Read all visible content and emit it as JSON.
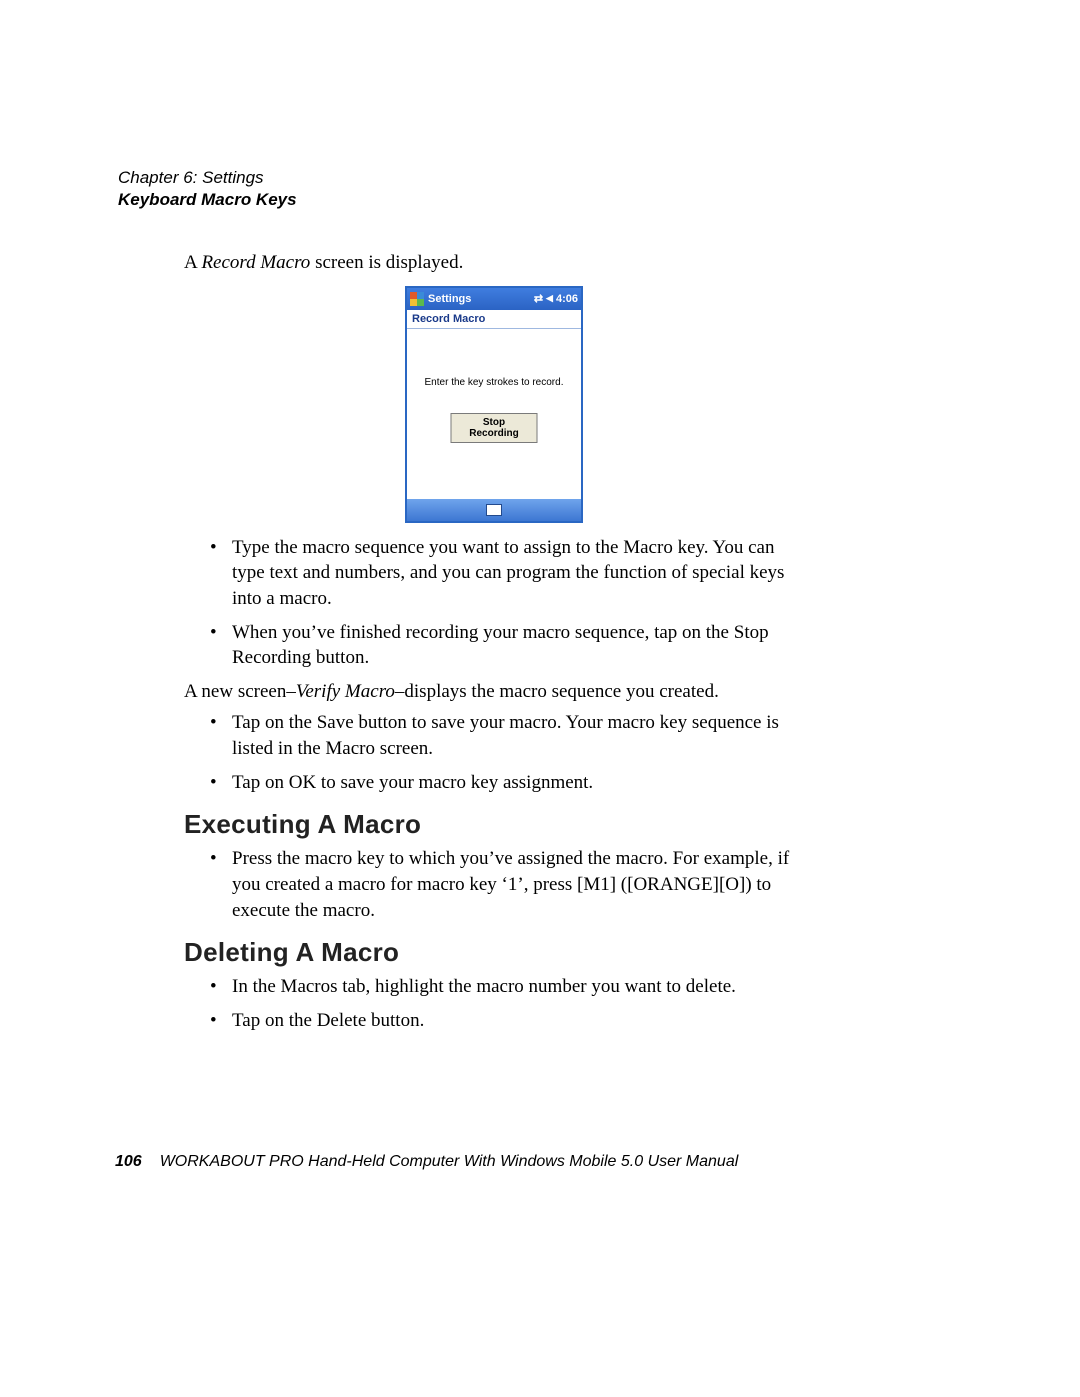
{
  "header": {
    "chapter": "Chapter 6:  Settings",
    "section": "Keyboard Macro Keys"
  },
  "intro": {
    "prefix": "A ",
    "italic": "Record Macro",
    "suffix": " screen is displayed."
  },
  "wm": {
    "title": "Settings",
    "time": "4:06",
    "subtitle": "Record Macro",
    "instruction": "Enter the key strokes to record.",
    "stop_button": "Stop Recording"
  },
  "bullets1": {
    "b1": "Type the macro sequence you want to assign to the Macro key. You can type text and numbers, and you can program the function of special keys into a macro.",
    "b2_pre": "When you’ve finished recording your macro sequence, tap on the ",
    "b2_bold": "Stop Recording",
    "b2_post": " button."
  },
  "verify": {
    "pre": "A new screen–",
    "italic": "Verify Macro",
    "post": "–displays the macro sequence you created."
  },
  "bullets2": {
    "b1_pre": "Tap on the ",
    "b1_bold": "Save",
    "b1_mid": " button to save your macro. Your macro key sequence is listed in the ",
    "b1_italic": "Macro",
    "b1_post": " screen.",
    "b2_pre": "Tap on ",
    "b2_bold": "OK",
    "b2_post": " to save your macro key assignment."
  },
  "exec": {
    "heading": "Executing A Macro",
    "b1": "Press the macro key to which you’ve assigned the macro. For example, if you created a macro for macro key ‘1’, press [M1] ([ORANGE][O]) to execute the macro."
  },
  "del": {
    "heading": "Deleting A Macro",
    "b1_pre": "In the ",
    "b1_italic": "Macros",
    "b1_post": " tab, highlight the macro number you want to delete.",
    "b2_pre": "Tap on the ",
    "b2_bold": "Delete",
    "b2_post": " button."
  },
  "footer": {
    "page": "106",
    "title": "WORKABOUT PRO Hand-Held Computer With Windows Mobile 5.0 User Manual"
  }
}
